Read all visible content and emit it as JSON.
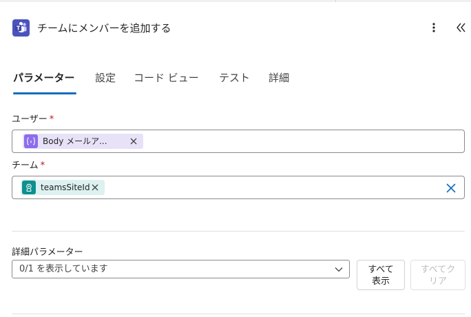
{
  "header": {
    "title": "チームにメンバーを追加する",
    "app_icon": "teams-icon",
    "more_icon": "more-vertical-icon",
    "collapse_icon": "double-chevron-left-icon"
  },
  "tabs": [
    {
      "label": "パラメーター",
      "active": true
    },
    {
      "label": "設定",
      "active": false
    },
    {
      "label": "コード ビュー",
      "active": false
    },
    {
      "label": "テスト",
      "active": false
    },
    {
      "label": "詳細",
      "active": false
    }
  ],
  "fields": {
    "user": {
      "label": "ユーザー",
      "required_mark": "*",
      "token": {
        "text": "Body メールア...",
        "icon": "expression-icon"
      }
    },
    "team": {
      "label": "チーム",
      "required_mark": "*",
      "token": {
        "text": "teamsSiteId",
        "icon": "teams-site-icon"
      }
    }
  },
  "advanced": {
    "label": "詳細パラメーター",
    "select_value": "0/1 を表示しています",
    "show_all": {
      "line1": "すべて",
      "line2": "表示"
    },
    "clear_all": {
      "line1": "すべてク",
      "line2": "リア"
    }
  },
  "colors": {
    "accent": "#0f6cbd",
    "required": "#c50f1f",
    "teams_brand": "#4b53bc",
    "token_user_bg": "#e8e2f8",
    "token_team_bg": "#ddf1f1"
  }
}
